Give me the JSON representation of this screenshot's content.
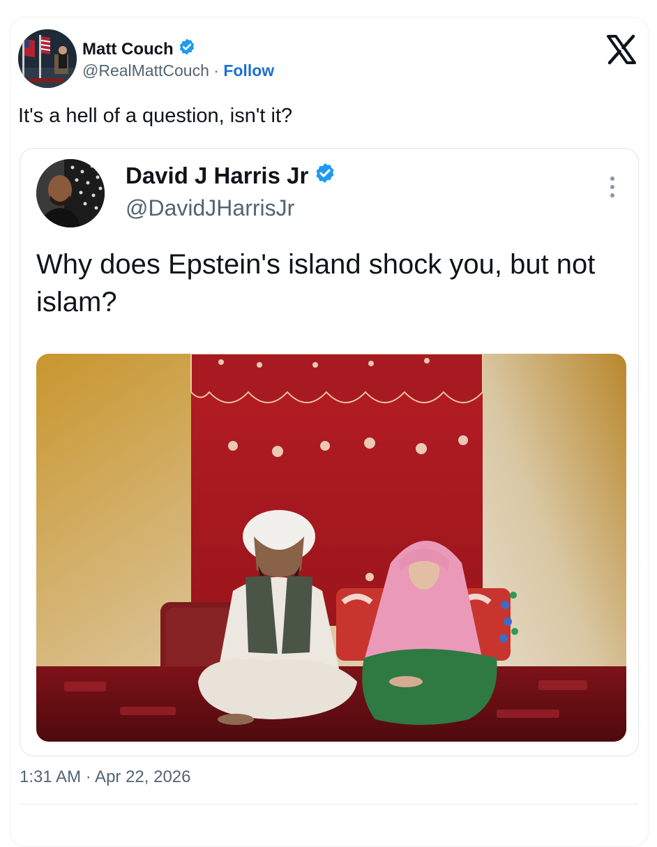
{
  "author": {
    "name": "Matt Couch",
    "handle": "@RealMattCouch",
    "separator": " · ",
    "follow_label": "Follow",
    "verified_icon": "verified-badge-icon"
  },
  "platform_icon": "x-logo-icon",
  "tweet": {
    "text": "It's a hell of a question, isn't it?",
    "timestamp": "1:31 AM · Apr 22, 2026"
  },
  "quoted_tweet": {
    "name": "David J Harris Jr",
    "handle": "@DavidJHarrisJr",
    "text": "Why does Epstein's island shock you, but not islam?",
    "more_icon": "more-options-icon"
  },
  "colors": {
    "accent": "#1d9bf0",
    "follow": "#1d6fd6",
    "secondary_text": "#536471"
  }
}
